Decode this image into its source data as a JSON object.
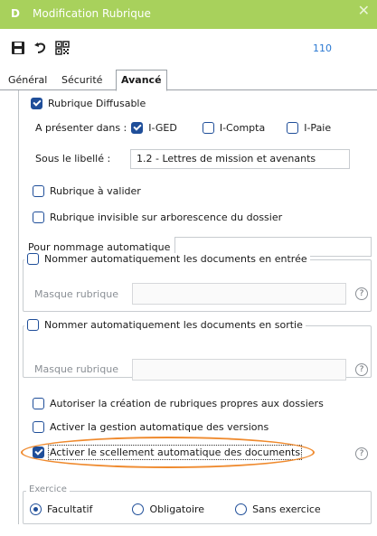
{
  "window": {
    "logo": "D",
    "title": "Modification Rubrique",
    "record_number": "110",
    "close_glyph": "✕"
  },
  "toolbar": {
    "icons": [
      "save-icon",
      "undo-icon",
      "qr-code-icon"
    ]
  },
  "tabs": [
    {
      "label": "Général",
      "active": false
    },
    {
      "label": "Sécurité",
      "active": false
    },
    {
      "label": "Avancé",
      "active": true
    }
  ],
  "diffusable": {
    "label": "Rubrique Diffusable",
    "checked": true,
    "presenter_label": "A présenter dans :",
    "targets": [
      {
        "label": "I-GED",
        "checked": true
      },
      {
        "label": "I-Compta",
        "checked": false
      },
      {
        "label": "I-Paie",
        "checked": false
      }
    ],
    "libelle_label": "Sous le libellé :",
    "libelle_value": "1.2 - Lettres de mission et avenants"
  },
  "options_top": [
    {
      "label": "Rubrique à valider",
      "checked": false
    },
    {
      "label": "Rubrique invisible sur arborescence du dossier",
      "checked": false
    }
  ],
  "nommage": {
    "label": "Pour nommage automatique",
    "value": ""
  },
  "entree_group": {
    "legend": "Nommer automatiquement les documents en entrée",
    "checked": false,
    "mask_label": "Masque rubrique",
    "mask_value": ""
  },
  "sortie_group": {
    "legend": "Nommer automatiquement les documents en sortie",
    "checked": false,
    "mask_label": "Masque rubrique",
    "mask_value": ""
  },
  "options_bottom": [
    {
      "label": "Autoriser la création de rubriques propres aux dossiers",
      "checked": false
    },
    {
      "label": "Activer la gestion automatique des versions",
      "checked": false
    },
    {
      "label": "Activer le scellement automatique des documents",
      "checked": true
    }
  ],
  "help_glyph": "?",
  "exercice": {
    "legend": "Exercice",
    "options": [
      {
        "label": "Facultatif",
        "selected": true
      },
      {
        "label": "Obligatoire",
        "selected": false
      },
      {
        "label": "Sans exercice",
        "selected": false
      }
    ]
  },
  "colors": {
    "titlebar": "#a8d15c",
    "accent": "#1f4e99",
    "link": "#2a78d2",
    "highlight": "#ef8a2e"
  }
}
